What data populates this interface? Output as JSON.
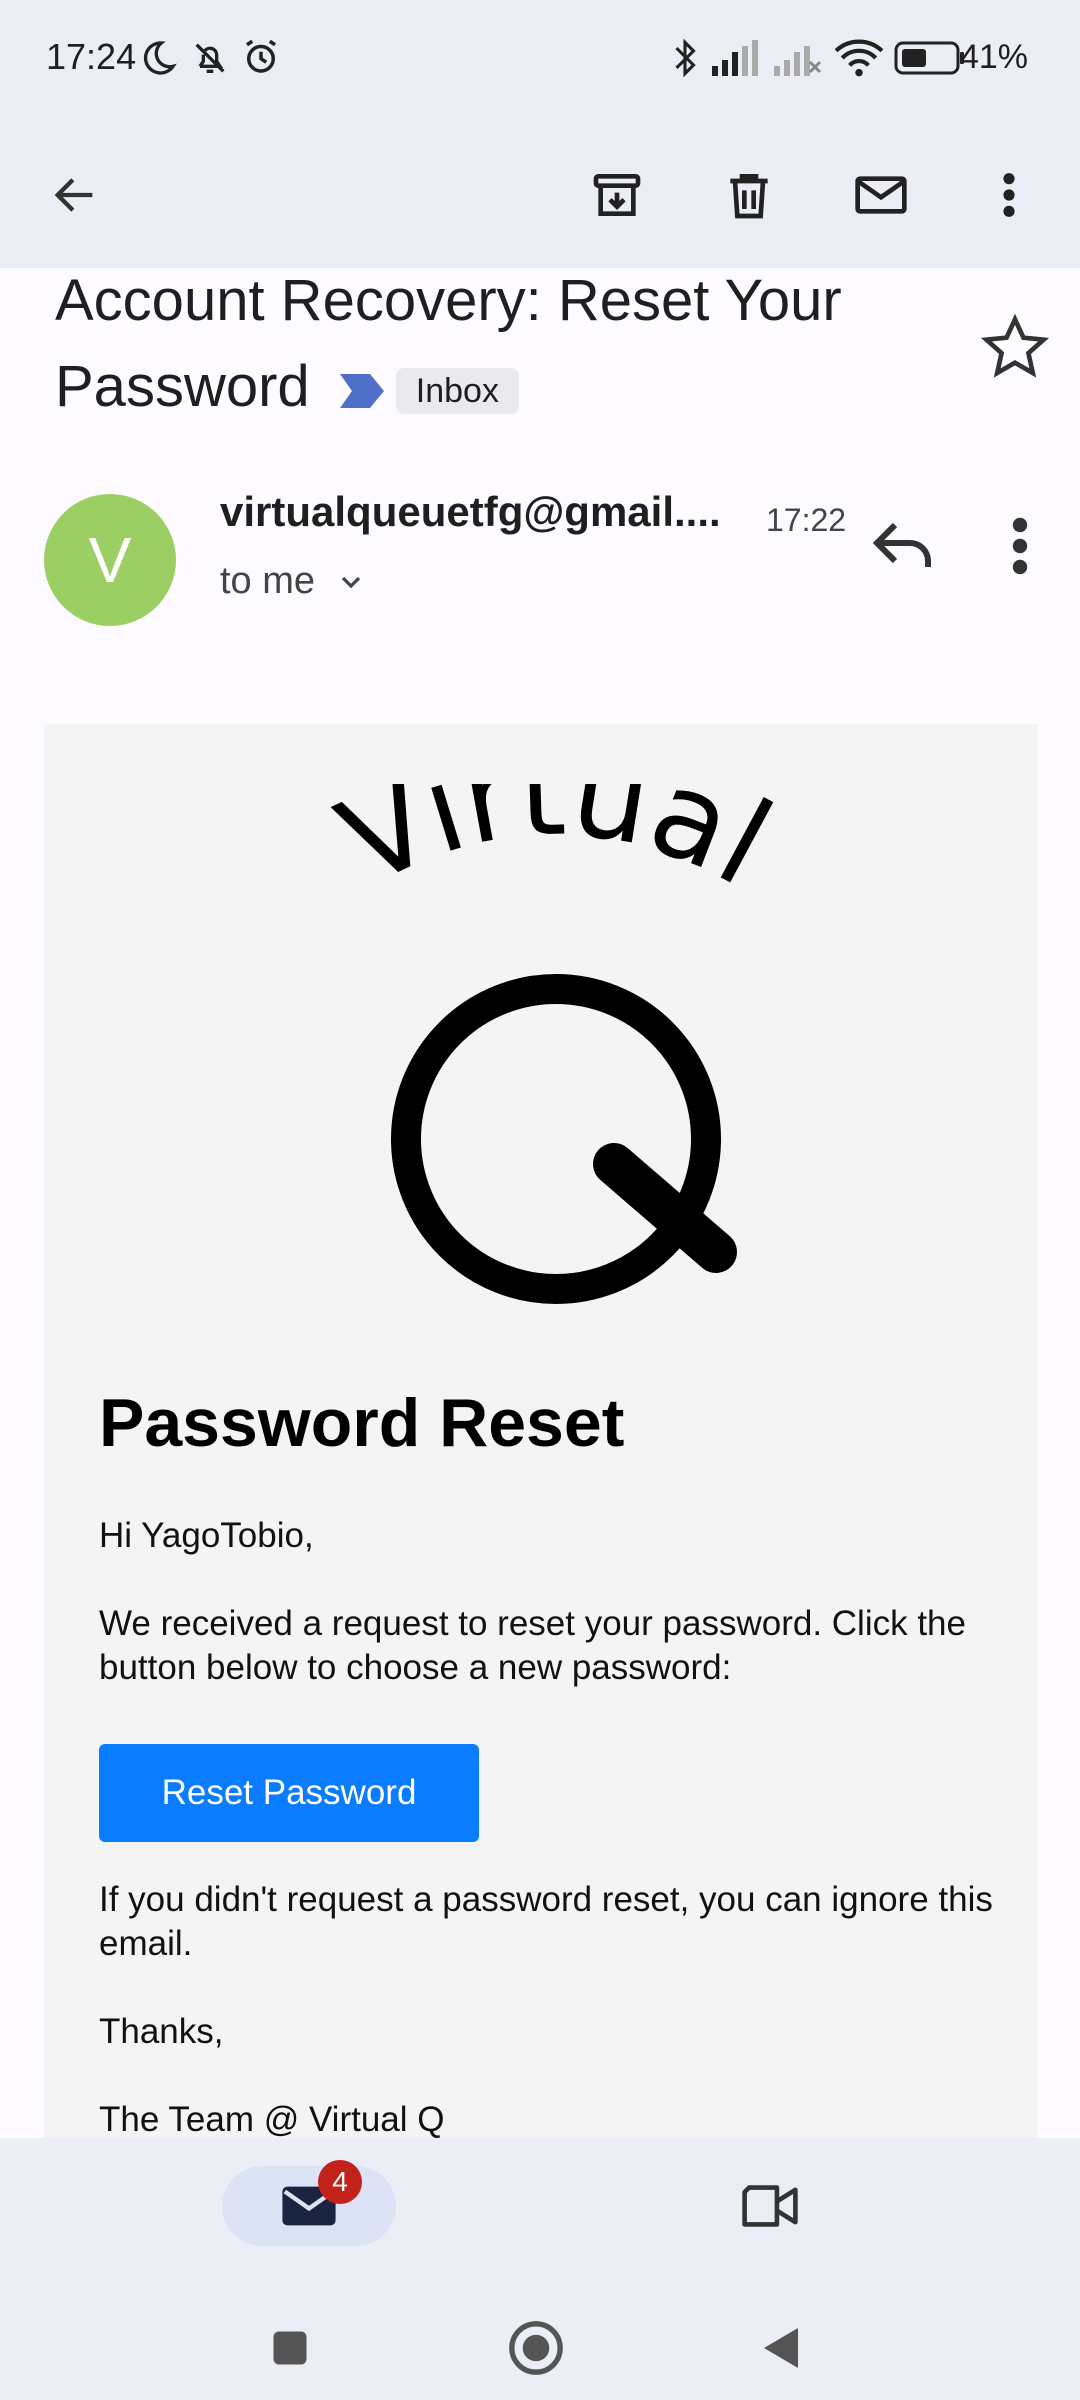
{
  "status_bar": {
    "time": "17:24",
    "battery": "41%",
    "icons": [
      "moon-icon",
      "bell-off-icon",
      "alarm-icon",
      "bluetooth-icon",
      "signal-icon",
      "signal-off-icon",
      "wifi-icon",
      "battery-icon"
    ]
  },
  "toolbar": {
    "icons": [
      "back-arrow-icon",
      "archive-icon",
      "delete-icon",
      "mark-unread-icon",
      "more-vert-icon"
    ]
  },
  "email": {
    "subject": "Account Recovery: Reset Your Password",
    "label": "Inbox",
    "sender_initial": "V",
    "sender": "virtualqueuetfg@gmail....",
    "time": "17:22",
    "recipient": "to me"
  },
  "body": {
    "logo_word": "Virtual",
    "logo_letter": "Q",
    "heading": "Password Reset",
    "greeting": "Hi YagoTobio,",
    "paragraph1": "We received a request to reset your password. Click the button below to choose a new password:",
    "button": "Reset Password",
    "paragraph2": "If you didn't request a password reset, you can ignore this email.",
    "thanks": "Thanks,",
    "signature": "The Team @ Virtual Q"
  },
  "bottom_nav": {
    "mail_badge": "4",
    "icons": [
      "mail-icon",
      "video-icon"
    ]
  },
  "colors": {
    "accent_button": "#0a7cff",
    "avatar": "#9ccf63",
    "badge": "#c3221b",
    "chrome": "#eceef5"
  }
}
